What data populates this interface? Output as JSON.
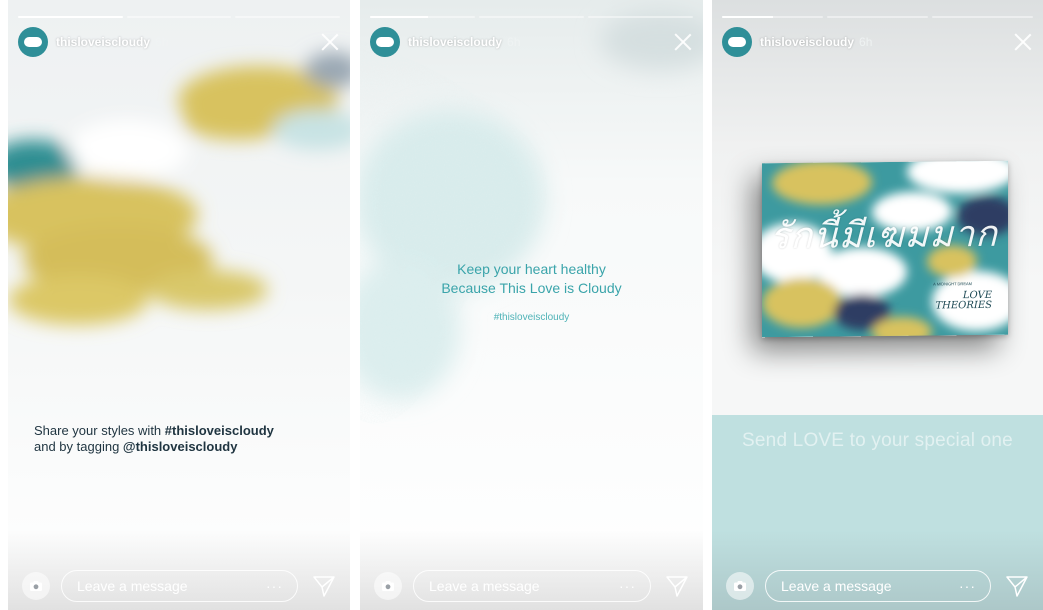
{
  "stories": [
    {
      "username": "thisloveiscloudy",
      "time": "6h",
      "progress": [
        1.0,
        0.0,
        0.0
      ],
      "share_prefix": "Share your styles with ",
      "share_hashtag": "#thisloveiscloudy",
      "tag_prefix": "and by tagging ",
      "tag_handle": "@thisloveiscloudy",
      "message_placeholder": "Leave a message",
      "more_label": "···"
    },
    {
      "username": "thisloveiscloudy",
      "time": "6h",
      "progress": [
        0.55,
        0.0,
        0.0
      ],
      "line1": "Keep your heart healthy",
      "line2": "Because This Love is Cloudy",
      "hashtag": "#thisloveiscloudy",
      "message_placeholder": "Leave a message",
      "more_label": "···"
    },
    {
      "username": "thisloveiscloudy",
      "time": "6h",
      "progress": [
        0.5,
        0.0,
        0.0
      ],
      "book_title": "รักนี้มีเฆมมาก",
      "book_tiny": "A MIDNIGHT DREAM",
      "book_subtitle_1": "LOVE",
      "book_subtitle_2": "THEORIES",
      "love_line": "Send LOVE to your special one",
      "message_placeholder": "Leave a message",
      "more_label": "···"
    }
  ],
  "colors": {
    "teal": "#2f8f98",
    "mustard": "#d4bd5a",
    "light_teal": "#bfe0e0",
    "navy": "#2d3e63",
    "text_teal": "#3aa4aa"
  }
}
